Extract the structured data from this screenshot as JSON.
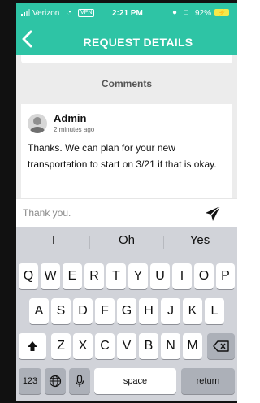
{
  "status_bar": {
    "carrier": "Verizon",
    "vpn": "VPN",
    "time": "2:21 PM",
    "battery_pct": "92%"
  },
  "header": {
    "title": "REQUEST DETAILS",
    "back_icon": "chevron-left-icon"
  },
  "comments": {
    "title": "Comments",
    "items": [
      {
        "author": "Admin",
        "time_ago": "2 minutes ago",
        "text": "Thanks. We can plan for your new transportation to start on 3/21 if that is okay."
      }
    ]
  },
  "input": {
    "value": "",
    "placeholder": "Thank you.",
    "send_icon": "send-icon"
  },
  "keyboard": {
    "suggestions": [
      "I",
      "Oh",
      "Yes"
    ],
    "row1": [
      "Q",
      "W",
      "E",
      "R",
      "T",
      "Y",
      "U",
      "I",
      "O",
      "P"
    ],
    "row2": [
      "A",
      "S",
      "D",
      "F",
      "G",
      "H",
      "J",
      "K",
      "L"
    ],
    "row3": [
      "Z",
      "X",
      "C",
      "V",
      "B",
      "N",
      "M"
    ],
    "numbers_key": "123",
    "space_key": "space",
    "return_key": "return"
  },
  "colors": {
    "accent": "#2ec4a5",
    "keyboard_bg": "#d1d3d9"
  }
}
